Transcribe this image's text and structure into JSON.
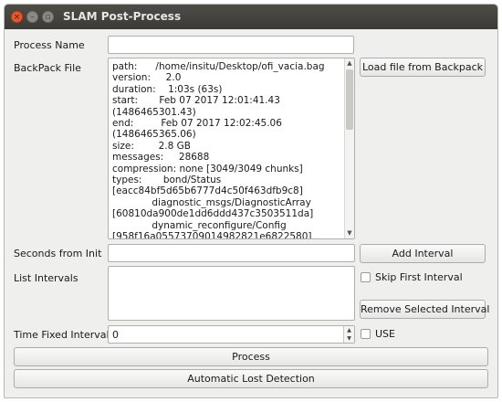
{
  "window": {
    "title": "SLAM Post-Process",
    "close_glyph": "×",
    "min_glyph": "–",
    "max_glyph": "▫"
  },
  "labels": {
    "process_name": "Process Name",
    "backpack_file": "BackPack File",
    "seconds_from_init": "Seconds from Init",
    "list_intervals": "List Intervals",
    "time_fixed_interval": "Time Fixed Interval"
  },
  "inputs": {
    "process_name": "",
    "seconds_from_init": "",
    "time_fixed_interval": "0"
  },
  "bag_info": {
    "lines": [
      "path:      /home/insitu/Desktop/ofi_vacia.bag",
      "version:     2.0",
      "duration:    1:03s (63s)",
      "start:       Feb 07 2017 12:01:41.43",
      "(1486465301.43)",
      "end:         Feb 07 2017 12:02:45.06",
      "(1486465365.06)",
      "size:        2.8 GB",
      "messages:     28688",
      "compression: none [3049/3049 chunks]",
      "types:       bond/Status",
      "[eacc84bf5d65b6777d4c50f463dfb9c8]",
      "             diagnostic_msgs/DiagnosticArray",
      "[60810da900de1dd6ddd437c3503511da]",
      "             dynamic_reconfigure/Config",
      "[958f16a05573709014982821e6822580]"
    ]
  },
  "buttons": {
    "load_file": "Load file from Backpack",
    "add_interval": "Add Interval",
    "remove_selected": "Remove Selected Interval",
    "process": "Process",
    "auto_lost_detection": "Automatic Lost Detection"
  },
  "checkboxes": {
    "skip_first_interval": {
      "label": "Skip First Interval",
      "checked": false
    },
    "use": {
      "label": "USE",
      "checked": false
    }
  },
  "icons": {
    "scroll_up": "▲",
    "scroll_down": "▼",
    "spin_up": "▲",
    "spin_down": "▼"
  },
  "colors": {
    "titlebar": "#3b3a36",
    "close_button": "#e9572d",
    "window_bg": "#efefee"
  }
}
